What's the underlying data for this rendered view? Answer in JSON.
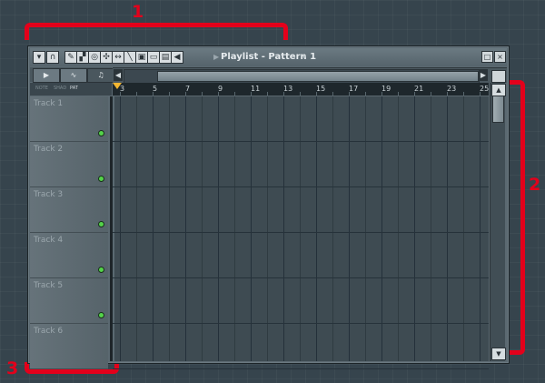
{
  "annotations": {
    "one": "1",
    "two": "2",
    "three": "3"
  },
  "window": {
    "title": "Playlist - Pattern 1",
    "tools": [
      "menu-arrow-icon",
      "magnet-icon",
      "draw-icon",
      "paint-icon",
      "delete-icon",
      "mute-icon",
      "slip-icon",
      "slice-icon",
      "select-icon",
      "zoom-icon",
      "playback-icon",
      "speaker-icon"
    ]
  },
  "left_tabs": {
    "pattern_label": "▶",
    "auto_label": "∿",
    "audio_label": "♫"
  },
  "modes": [
    "NOTE",
    "SHAD",
    "PAT"
  ],
  "ruler": {
    "ticks": [
      "3",
      "5",
      "7",
      "9",
      "11",
      "13",
      "15",
      "17",
      "19",
      "21",
      "23",
      "25"
    ]
  },
  "tracks": [
    {
      "label": "Track 1"
    },
    {
      "label": "Track 2"
    },
    {
      "label": "Track 3"
    },
    {
      "label": "Track 4"
    },
    {
      "label": "Track 5"
    },
    {
      "label": "Track 6"
    }
  ],
  "colors": {
    "accent": "#e3001b",
    "led": "#54d34a",
    "marker": "#f2b632"
  }
}
